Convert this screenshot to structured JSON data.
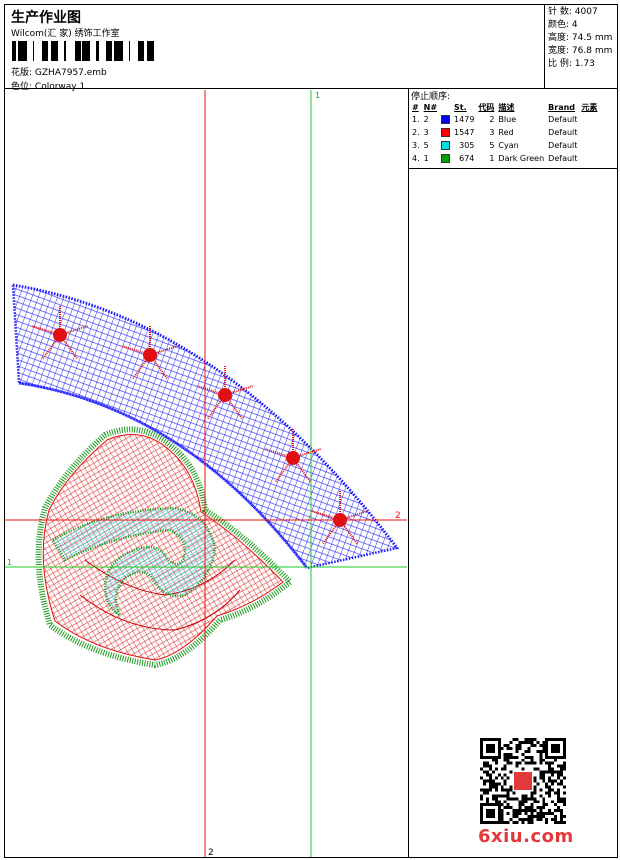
{
  "header": {
    "title": "生产作业图",
    "company": "Wilcom(汇 家) 绣饰工作室",
    "design_label": "花版:",
    "design_file": "GZHA7957.emb",
    "colorway_label": "色位:",
    "colorway": "Colorway 1"
  },
  "stats": [
    {
      "label": "针 数:",
      "value": "4007"
    },
    {
      "label": "颜色:",
      "value": "4"
    },
    {
      "label": "高度:",
      "value": "74.5 mm"
    },
    {
      "label": "宽度:",
      "value": "76.8 mm"
    },
    {
      "label": "比 例:",
      "value": "1.73"
    }
  ],
  "sequence": {
    "title": "停止顺序:",
    "headers": [
      "#",
      "N#",
      "",
      "St.",
      "代码",
      "描述",
      "Brand",
      "元素"
    ],
    "rows": [
      {
        "idx": "1.",
        "n": "2",
        "color": "#0000ff",
        "st": "1479",
        "code": "2",
        "desc": "Blue",
        "brand": "Default"
      },
      {
        "idx": "2.",
        "n": "3",
        "color": "#ff0000",
        "st": "1547",
        "code": "3",
        "desc": "Red",
        "brand": "Default"
      },
      {
        "idx": "3.",
        "n": "5",
        "color": "#00e0e0",
        "st": "305",
        "code": "5",
        "desc": "Cyan",
        "brand": "Default"
      },
      {
        "idx": "4.",
        "n": "1",
        "color": "#00a000",
        "st": "674",
        "code": "1",
        "desc": "Dark Green",
        "brand": "Default"
      }
    ]
  },
  "guides": {
    "green_v": "1",
    "green_h": "1",
    "red_h": "2",
    "red_v": "2"
  },
  "colors": {
    "blue": "#1a1aff",
    "red": "#e01010",
    "cyan": "#33e0e8",
    "green": "#1a9a1a"
  },
  "watermark": "6xiu.com"
}
